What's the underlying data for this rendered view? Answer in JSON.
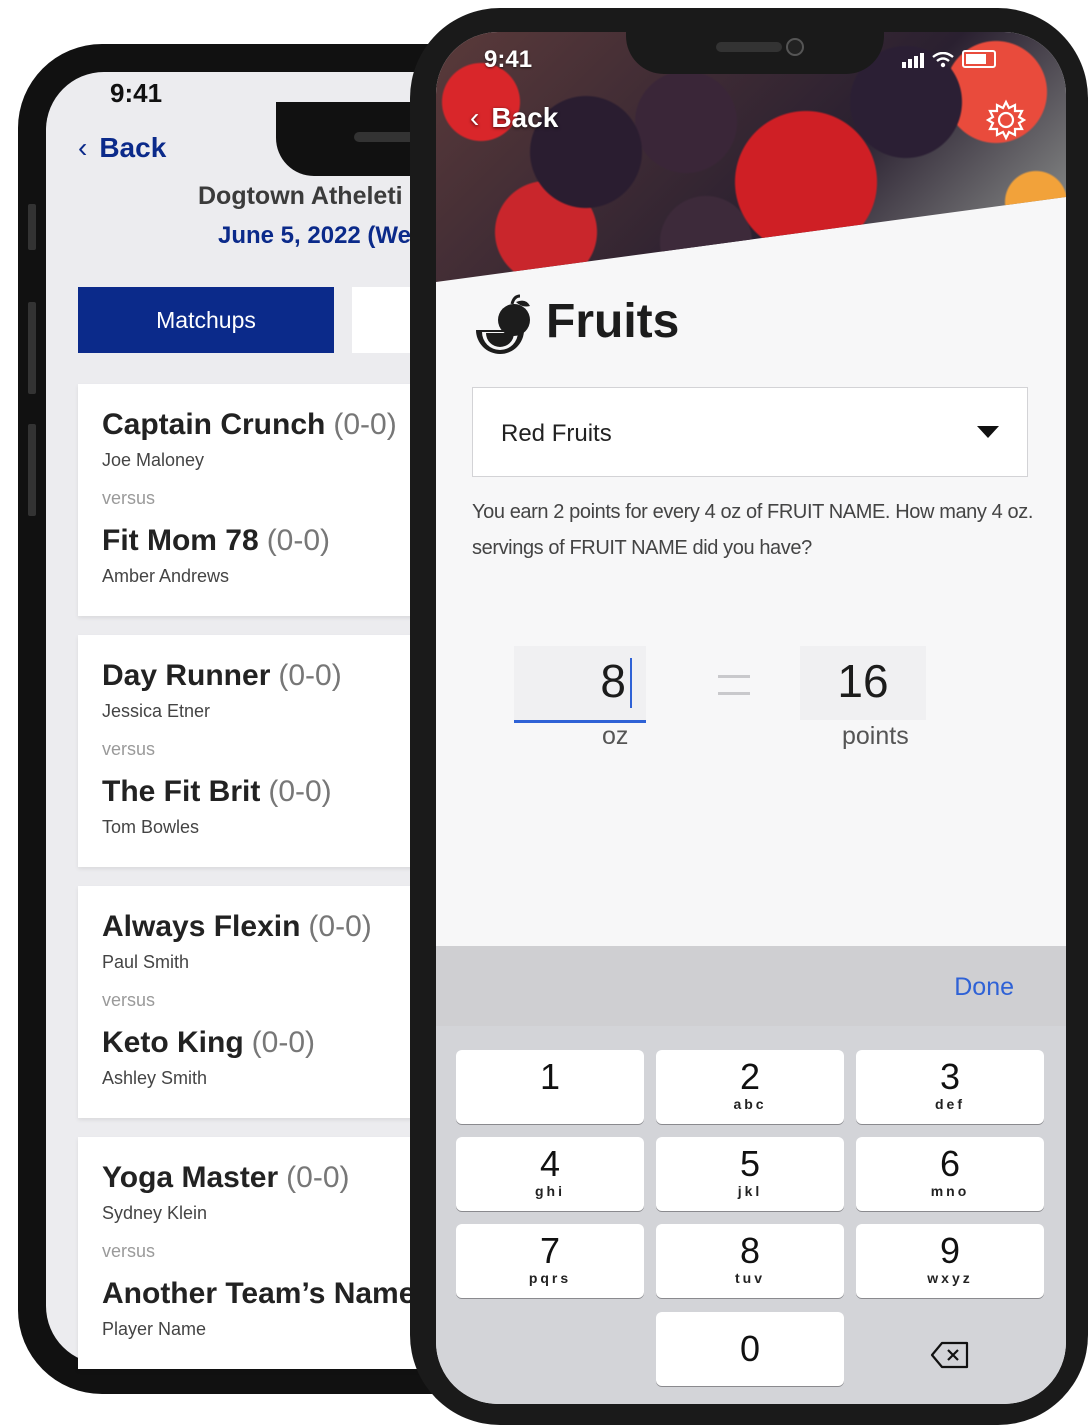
{
  "back_phone": {
    "status_time": "9:41",
    "back_label": "Back",
    "organization": "Dogtown Atheleti",
    "date": "June 5, 2022 (We",
    "tabs": [
      {
        "label": "Matchups"
      },
      {
        "label": ""
      }
    ],
    "versus_label": "versus",
    "matchups": [
      {
        "team1": "Captain Crunch",
        "record1": "(0-0)",
        "player1": "Joe Maloney",
        "team2": "Fit Mom 78",
        "record2": "(0-0)",
        "player2": "Amber Andrews"
      },
      {
        "team1": "Day Runner",
        "record1": "(0-0)",
        "player1": "Jessica Etner",
        "team2": "The Fit Brit",
        "record2": "(0-0)",
        "player2": "Tom Bowles"
      },
      {
        "team1": "Always Flexin",
        "record1": "(0-0)",
        "player1": "Paul Smith",
        "team2": "Keto King",
        "record2": "(0-0)",
        "player2": "Ashley Smith"
      },
      {
        "team1": "Yoga Master",
        "record1": "(0-0)",
        "player1": "Sydney Klein",
        "team2": "Another Team’s Name",
        "record2": "",
        "player2": "Player Name"
      }
    ]
  },
  "front_phone": {
    "status_time": "9:41",
    "back_label": "Back",
    "title": "Fruits",
    "dropdown_value": "Red Fruits",
    "description": "You earn 2 points for every 4 oz of FRUIT NAME. How many 4 oz. servings of FRUIT NAME did you have?",
    "oz_value": "8",
    "oz_unit": "oz",
    "points_value": "16",
    "points_unit": "points",
    "done_label": "Done",
    "keypad": [
      {
        "digit": "1",
        "letters": ""
      },
      {
        "digit": "2",
        "letters": "abc"
      },
      {
        "digit": "3",
        "letters": "def"
      },
      {
        "digit": "4",
        "letters": "ghi"
      },
      {
        "digit": "5",
        "letters": "jkl"
      },
      {
        "digit": "6",
        "letters": "mno"
      },
      {
        "digit": "7",
        "letters": "pqrs"
      },
      {
        "digit": "8",
        "letters": "tuv"
      },
      {
        "digit": "9",
        "letters": "wxyz"
      },
      {
        "digit": "0",
        "letters": ""
      }
    ],
    "icons": [
      "chevron-left-icon",
      "gear-icon",
      "fruit-icon",
      "chevron-down-icon",
      "backspace-icon",
      "signal-icon",
      "wifi-icon",
      "battery-icon"
    ],
    "colors": {
      "accent": "#2f62d6",
      "navy": "#0b2a8a"
    }
  }
}
